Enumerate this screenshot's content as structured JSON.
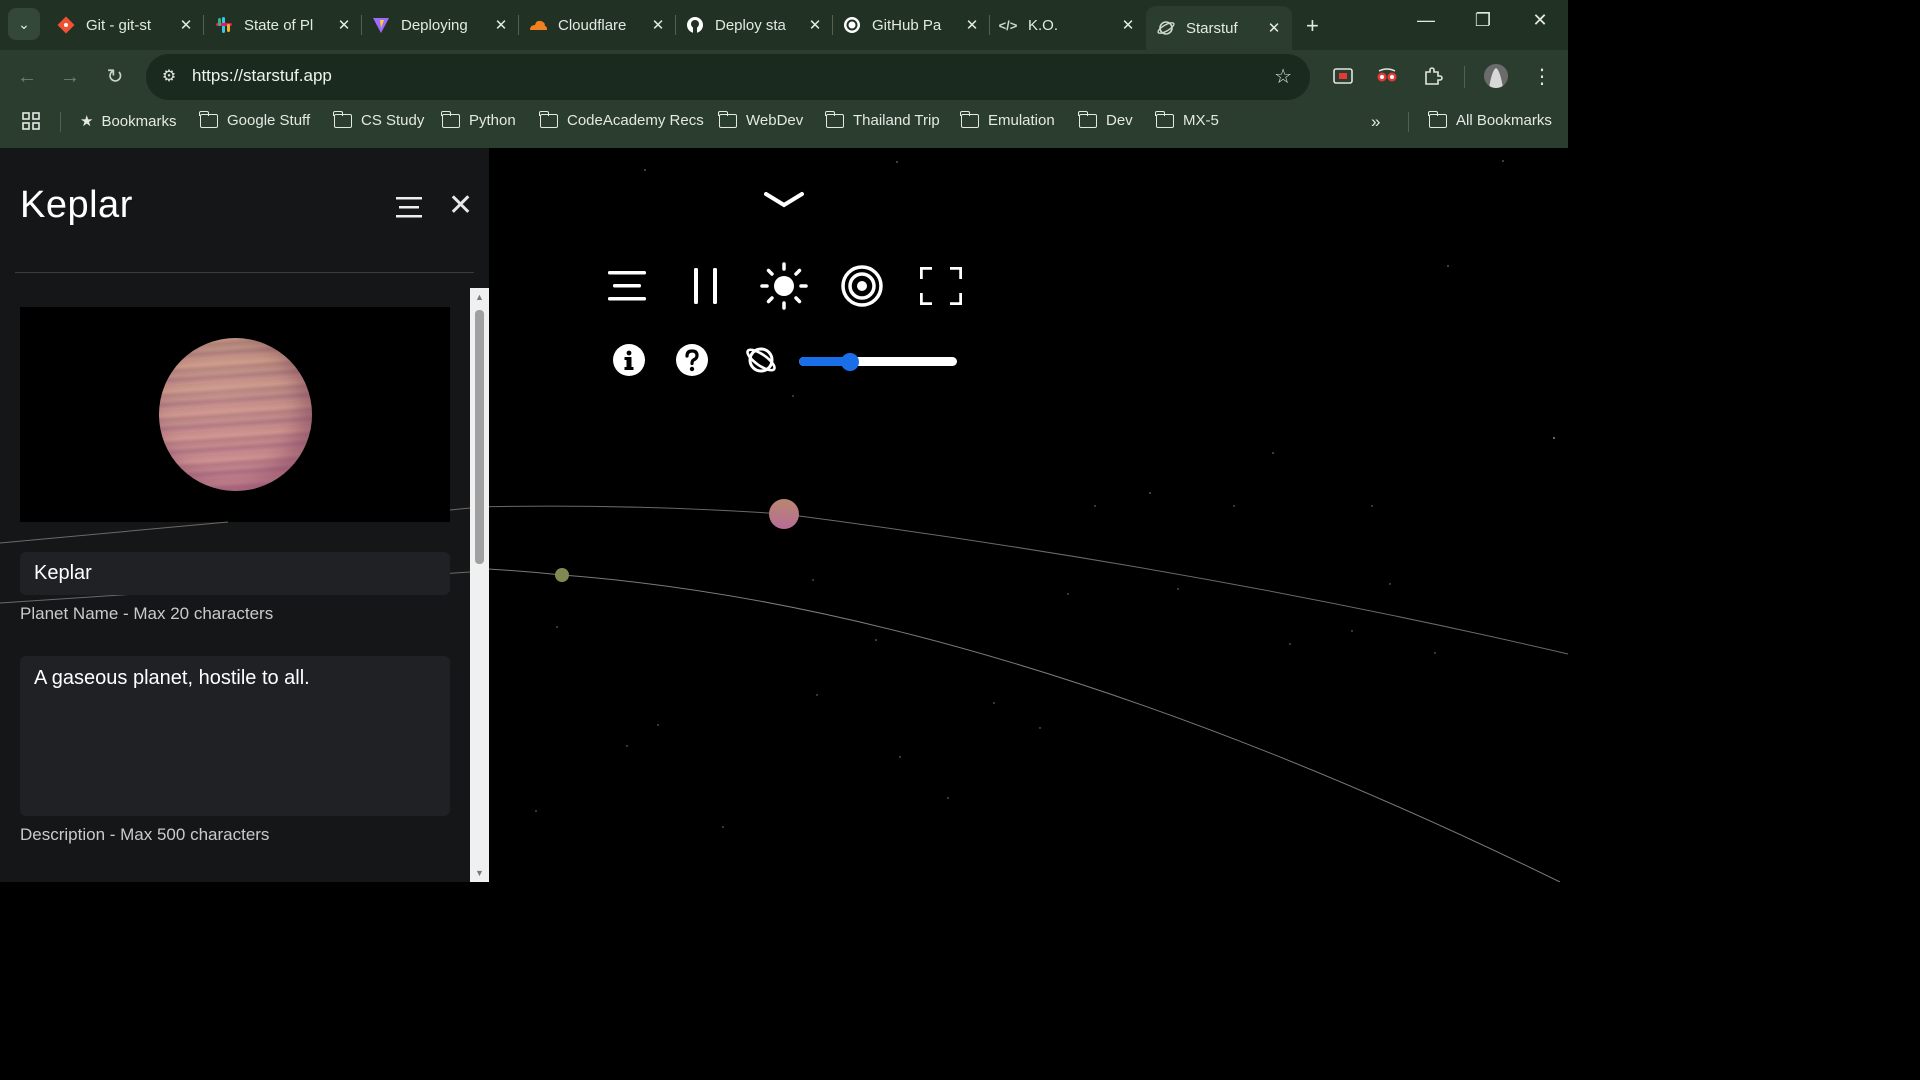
{
  "browser": {
    "tabs": [
      {
        "label": "Git - git-st",
        "icon": "git-icon",
        "color": "#f05133"
      },
      {
        "label": "State of Pl",
        "icon": "slack-icon",
        "color": "#e01e5a"
      },
      {
        "label": "Deploying",
        "icon": "vite-icon",
        "color": "#9d6bff"
      },
      {
        "label": "Cloudflare",
        "icon": "cloudflare-icon",
        "color": "#f38020"
      },
      {
        "label": "Deploy sta",
        "icon": "github-icon",
        "color": "#ffffff"
      },
      {
        "label": "GitHub Pa",
        "icon": "openai-icon",
        "color": "#ffffff"
      },
      {
        "label": "K.O.",
        "icon": "code-icon",
        "color": "#cfd8d1"
      },
      {
        "label": "Starstuf",
        "icon": "starstuf-icon",
        "color": "#cfd8d1"
      }
    ],
    "active_tab_index": 7,
    "url": "https://starstuf.app",
    "bookmarks": {
      "label": "Bookmarks",
      "folders": [
        "Google Stuff",
        "CS Study",
        "Python",
        "CodeAcademy Recs",
        "WebDev",
        "Thailand Trip",
        "Emulation",
        "Dev",
        "MX-5"
      ],
      "overflow": "»",
      "all": "All Bookmarks"
    }
  },
  "panel": {
    "title": "Keplar",
    "planet_name": "Keplar",
    "name_hint": "Planet Name - Max 20 characters",
    "description": "A gaseous planet, hostile to all.",
    "description_hint": "Description - Max 500 characters"
  },
  "controls": {
    "icons": [
      "collapse-chevron-icon",
      "menu-icon",
      "pause-icon",
      "sun-icon",
      "target-icon",
      "fullscreen-icon",
      "info-icon",
      "help-icon",
      "planet-icon"
    ],
    "speed_slider": 0.32
  },
  "colors": {
    "accent": "#1a6fe8",
    "panel_bg": "#151618",
    "field_bg": "#1f2124"
  }
}
